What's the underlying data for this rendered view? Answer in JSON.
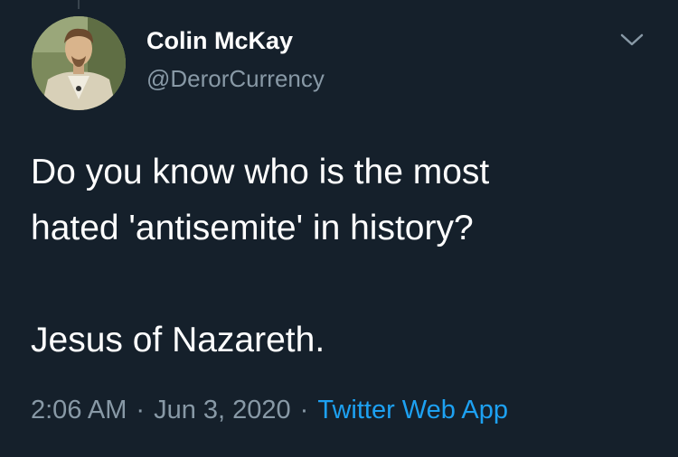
{
  "author": {
    "display_name": "Colin McKay",
    "handle": "@DerorCurrency"
  },
  "tweet": {
    "lines": [
      "Do you know who is the most",
      "hated 'antisemite' in history?",
      "Jesus of Nazareth."
    ]
  },
  "meta": {
    "time": "2:06 AM",
    "separator": "·",
    "date": "Jun 3, 2020",
    "source": "Twitter Web App"
  },
  "icons": {
    "menu": "chevron-down-icon",
    "avatar": "profile-photo"
  },
  "colors": {
    "background": "#15202b",
    "primary_text": "#ffffff",
    "secondary_text": "#8899a6",
    "link": "#1da1f2"
  }
}
